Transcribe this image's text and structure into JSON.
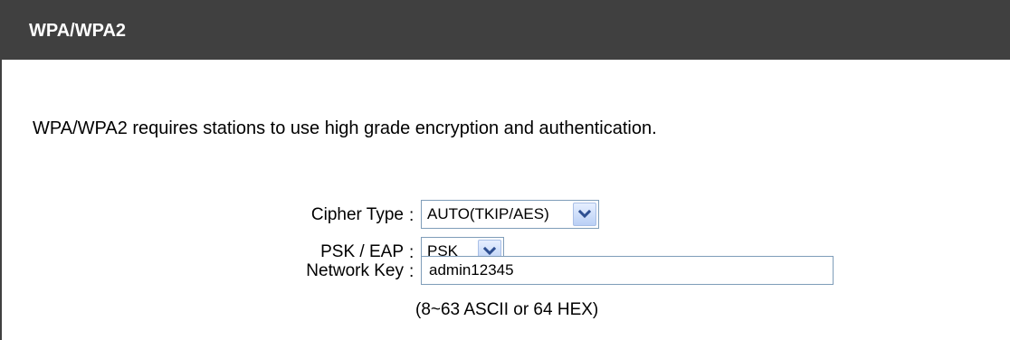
{
  "section": {
    "title": "WPA/WPA2",
    "description": "WPA/WPA2 requires stations to use high grade encryption and authentication."
  },
  "form": {
    "separator": ":",
    "cipher_type": {
      "label": "Cipher Type",
      "value": "AUTO(TKIP/AES)"
    },
    "psk_eap": {
      "label": "PSK / EAP",
      "value": "PSK"
    },
    "network_key": {
      "label": "Network Key",
      "value": "admin12345"
    },
    "hint": "(8~63 ASCII or 64 HEX)"
  },
  "icons": {
    "dropdown": "chevron-down-icon"
  },
  "colors": {
    "header_background": "#404040",
    "header_text": "#ffffff",
    "field_border": "#7f9db9",
    "dropdown_arrow": "#2e4f91"
  }
}
